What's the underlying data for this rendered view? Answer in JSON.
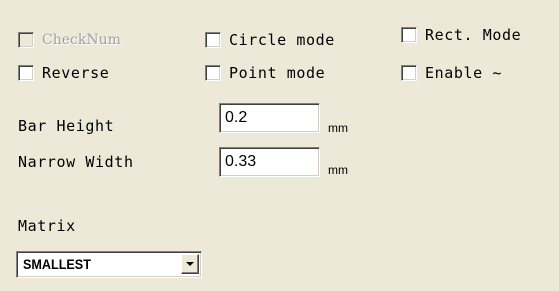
{
  "checkboxes": {
    "checknum": {
      "label": "CheckNum",
      "checked": false,
      "enabled": false
    },
    "circle_mode": {
      "label": "Circle mode",
      "checked": false,
      "enabled": true
    },
    "rect_mode": {
      "label": "Rect. Mode",
      "checked": false,
      "enabled": true
    },
    "reverse": {
      "label": "Reverse",
      "checked": false,
      "enabled": true
    },
    "point_mode": {
      "label": "Point mode",
      "checked": false,
      "enabled": true
    },
    "enable": {
      "label": "Enable ~",
      "checked": false,
      "enabled": true
    }
  },
  "fields": {
    "bar_height": {
      "label": "Bar Height",
      "value": "0.2",
      "unit": "mm"
    },
    "narrow_width": {
      "label": "Narrow Width",
      "value": "0.33",
      "unit": "mm"
    }
  },
  "matrix": {
    "label": "Matrix",
    "selected": "SMALLEST"
  }
}
